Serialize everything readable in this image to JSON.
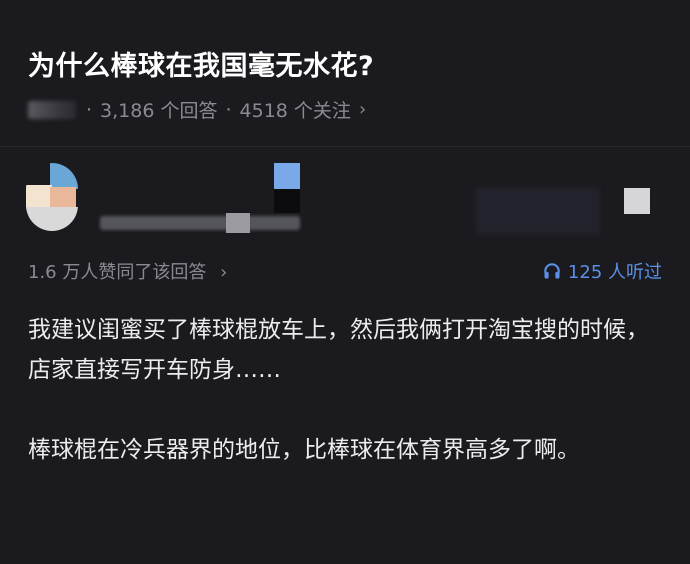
{
  "question": {
    "title": "为什么棒球在我国毫无水花?",
    "answers_count": "3,186 个回答",
    "separator": "·",
    "followers": "4518 个关注"
  },
  "answer": {
    "likes_text": "1.6 万人赞同了该回答",
    "listen_text": "125 人听过",
    "paragraphs": [
      "我建议闺蜜买了棒球棍放车上，然后我俩打开淘宝搜的时候，店家直接写开车防身……",
      "棒球棍在冷兵器界的地位，比棒球在体育界高多了啊。"
    ]
  },
  "colors": {
    "background": "#1b1b1f",
    "accent": "#5b8fe8",
    "muted": "#8a8a90"
  },
  "icons": {
    "meta_chevron": "chevron-right-icon",
    "likes_chevron": "chevron-right-icon",
    "listen": "headphones-icon"
  }
}
